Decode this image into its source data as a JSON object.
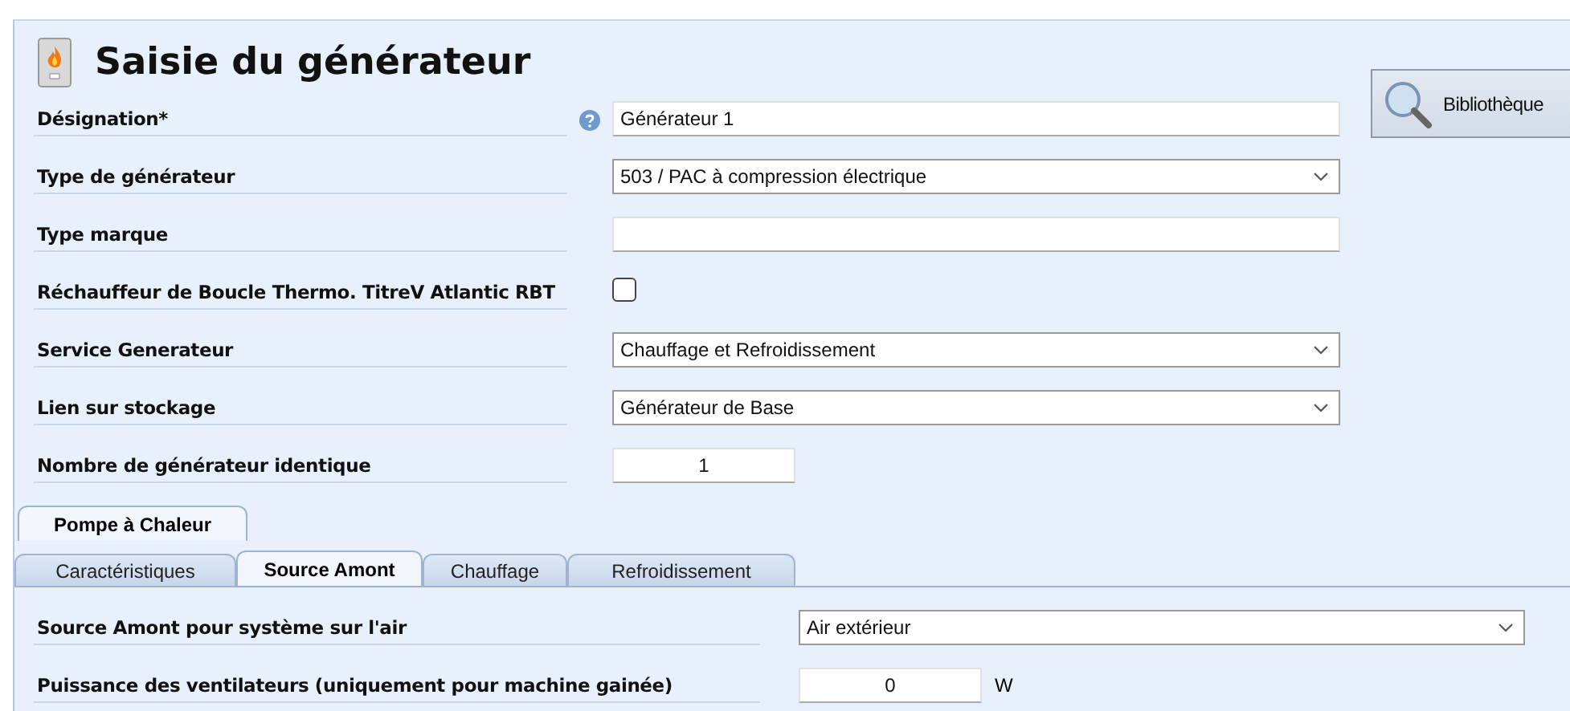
{
  "header": {
    "title": "Saisie du générateur"
  },
  "library_button": {
    "label": "Bibliothèque"
  },
  "fields": [
    {
      "kind": "text",
      "label": "Désignation*",
      "help": true,
      "value": "Générateur 1"
    },
    {
      "kind": "combo",
      "label": "Type de générateur",
      "help": false,
      "value": "503 / PAC à compression électrique"
    },
    {
      "kind": "text",
      "label": "Type marque",
      "help": false
    },
    {
      "kind": "checkbox",
      "label": "Réchauffeur de Boucle Thermo. TitreV Atlantic RBT",
      "help": false,
      "checked": false
    },
    {
      "kind": "combo",
      "label": "Service Generateur",
      "help": false,
      "value": "Chauffage et Refroidissement"
    },
    {
      "kind": "combo",
      "label": "Lien sur stockage",
      "help": false,
      "value": "Générateur de Base"
    },
    {
      "kind": "number",
      "label": "Nombre de générateur identique",
      "help": false,
      "value": "1"
    }
  ],
  "outer_tabs": [
    {
      "label": "Pompe à Chaleur",
      "selected": true
    }
  ],
  "inner_tabs": [
    {
      "label": "Caractéristiques",
      "selected": false
    },
    {
      "label": "Source Amont",
      "selected": true
    },
    {
      "label": "Chauffage",
      "selected": false
    },
    {
      "label": "Refroidissement",
      "selected": false
    }
  ],
  "tab_fields": [
    {
      "kind": "combo",
      "label": "Source Amont pour système sur l'air",
      "value": "Air extérieur"
    },
    {
      "kind": "number",
      "label": "Puissance des ventilateurs (uniquement pour machine gainée)",
      "value": "0",
      "unit": "W"
    }
  ]
}
